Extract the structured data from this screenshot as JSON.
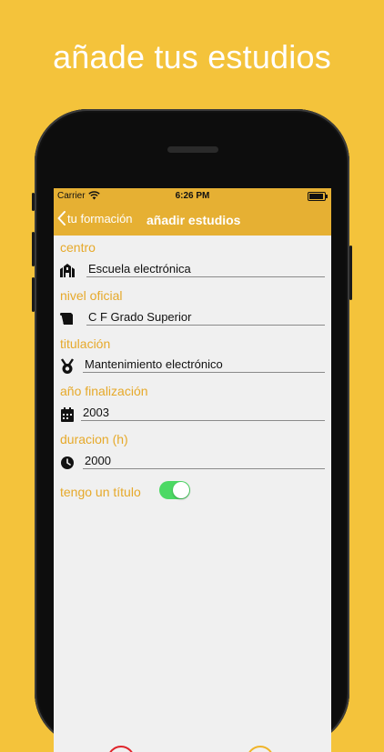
{
  "promo": {
    "headline": "añade tus estudios"
  },
  "status_bar": {
    "carrier": "Carrier",
    "time": "6:26 PM"
  },
  "nav": {
    "back_label": "tu formación",
    "title": "añadir estudios"
  },
  "form": {
    "fields": [
      {
        "label": "centro",
        "value": "Escuela electrónica",
        "icon": "school-building-icon"
      },
      {
        "label": "nivel oficial",
        "value": "C F Grado Superior",
        "icon": "diploma-scroll-icon"
      },
      {
        "label": "titulación",
        "value": "Mantenimiento electrónico",
        "icon": "medal-icon"
      },
      {
        "label": "año finalización",
        "value": "2003",
        "icon": "calendar-icon"
      },
      {
        "label": "duracion (h)",
        "value": "2000",
        "icon": "clock-icon"
      }
    ],
    "toggle": {
      "label": "tengo un título",
      "on": true
    }
  },
  "colors": {
    "background": "#F4C33B",
    "bar": "#E6B033",
    "label": "#E6A92A",
    "toggle_on": "#4CD964",
    "delete": "#E0252B",
    "save": "#F0B429"
  },
  "actions": {
    "delete_icon": "trash-icon",
    "save_icon": "save-floppy-icon"
  }
}
